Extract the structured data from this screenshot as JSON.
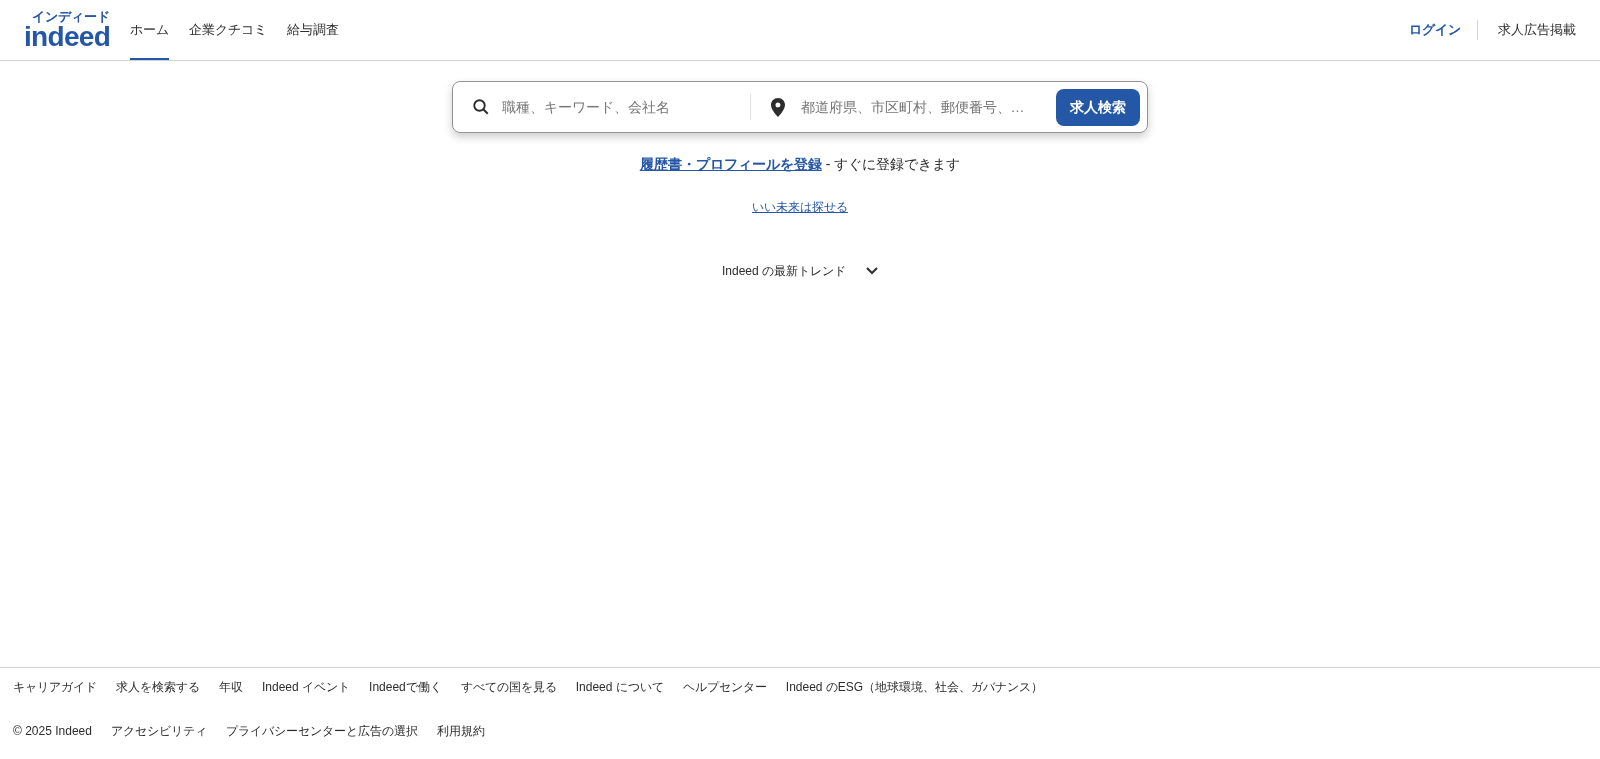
{
  "header": {
    "logo": {
      "text": "indeed",
      "kana": "インディード"
    },
    "nav": [
      {
        "label": "ホーム",
        "selected": true
      },
      {
        "label": "企業クチコミ",
        "selected": false
      },
      {
        "label": "給与調査",
        "selected": false
      }
    ],
    "login": "ログイン",
    "post_job": "求人広告掲載"
  },
  "search": {
    "what_placeholder": "職種、キーワード、会社名",
    "where_placeholder": "都道府県、市区町村、郵便番号、…",
    "button": "求人検索"
  },
  "register": {
    "link": "履歴書・プロフィールを登録",
    "text": " - すぐに登録できます"
  },
  "future_link": "いい未来は探せる",
  "trends": {
    "label": "Indeed の最新トレンド",
    "expanded": false
  },
  "footer": {
    "links": [
      "キャリアガイド",
      "求人を検索する",
      "年収",
      "Indeed イベント",
      "Indeedで働く",
      "すべての国を見る",
      "Indeed について",
      "ヘルプセンター",
      "Indeed のESG（地球環境、社会、ガバナンス）"
    ],
    "copyright": "© 2025 Indeed",
    "links2": [
      "アクセシビリティ",
      "プライバシーセンターと広告の選択",
      "利用規約"
    ]
  }
}
